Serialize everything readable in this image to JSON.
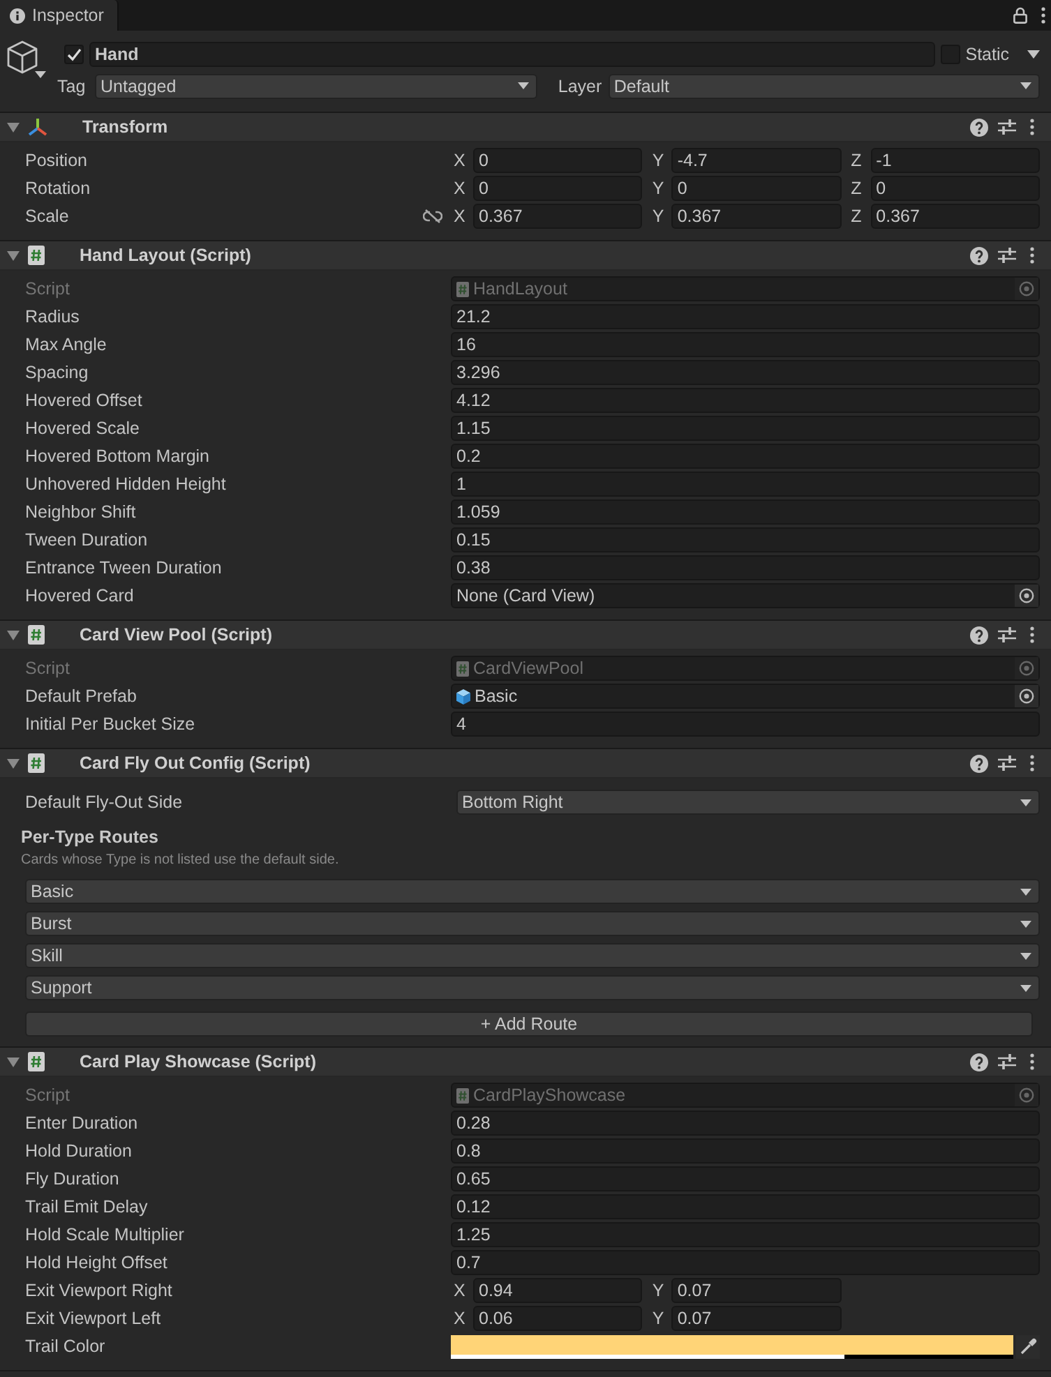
{
  "tab": {
    "label": "Inspector"
  },
  "object": {
    "active": true,
    "name": "Hand",
    "static": false,
    "static_label": "Static",
    "tag_label": "Tag",
    "tag": "Untagged",
    "layer_label": "Layer",
    "layer": "Default"
  },
  "components": [
    {
      "kind": "transform",
      "title": "Transform",
      "expanded": true,
      "rows": [
        {
          "kind": "vector",
          "label": "Position",
          "axes": [
            {
              "axis": "X",
              "value": "0"
            },
            {
              "axis": "Y",
              "value": "-4.7"
            },
            {
              "axis": "Z",
              "value": "-1"
            }
          ]
        },
        {
          "kind": "vector",
          "label": "Rotation",
          "axes": [
            {
              "axis": "X",
              "value": "0"
            },
            {
              "axis": "Y",
              "value": "0"
            },
            {
              "axis": "Z",
              "value": "0"
            }
          ]
        },
        {
          "kind": "scale",
          "label": "Scale",
          "axes": [
            {
              "axis": "X",
              "value": "0.367"
            },
            {
              "axis": "Y",
              "value": "0.367"
            },
            {
              "axis": "Z",
              "value": "0.367"
            }
          ]
        }
      ]
    },
    {
      "kind": "script",
      "title": "Hand Layout (Script)",
      "expanded": true,
      "rows": [
        {
          "kind": "script",
          "label": "Script",
          "value": "HandLayout"
        },
        {
          "kind": "number",
          "label": "Radius",
          "value": "21.2"
        },
        {
          "kind": "number",
          "label": "Max Angle",
          "value": "16"
        },
        {
          "kind": "number",
          "label": "Spacing",
          "value": "3.296"
        },
        {
          "kind": "number",
          "label": "Hovered Offset",
          "value": "4.12"
        },
        {
          "kind": "number",
          "label": "Hovered Scale",
          "value": "1.15"
        },
        {
          "kind": "number",
          "label": "Hovered Bottom Margin",
          "value": "0.2"
        },
        {
          "kind": "number",
          "label": "Unhovered Hidden Height",
          "value": "1"
        },
        {
          "kind": "number",
          "label": "Neighbor Shift",
          "value": "1.059"
        },
        {
          "kind": "number",
          "label": "Tween Duration",
          "value": "0.15"
        },
        {
          "kind": "number",
          "label": "Entrance Tween Duration",
          "value": "0.38"
        },
        {
          "kind": "object",
          "label": "Hovered Card",
          "value": "None (Card View)"
        }
      ]
    },
    {
      "kind": "script",
      "title": "Card View Pool (Script)",
      "expanded": true,
      "rows": [
        {
          "kind": "script",
          "label": "Script",
          "value": "CardViewPool"
        },
        {
          "kind": "prefab",
          "label": "Default Prefab",
          "value": "Basic"
        },
        {
          "kind": "number",
          "label": "Initial Per Bucket Size",
          "value": "4"
        }
      ]
    },
    {
      "kind": "script",
      "title": "Card Fly Out Config (Script)",
      "expanded": true,
      "rows": [
        {
          "kind": "dropdown",
          "label": "Default Fly-Out Side",
          "value": "Bottom Right"
        }
      ],
      "routes": {
        "title": "Per-Type Routes",
        "note": "Cards whose Type is not listed use the default side.",
        "items": [
          "Basic",
          "Burst",
          "Skill",
          "Support"
        ],
        "add_button": "+ Add Route"
      }
    },
    {
      "kind": "script",
      "title": "Card Play Showcase (Script)",
      "expanded": true,
      "rows": [
        {
          "kind": "script",
          "label": "Script",
          "value": "CardPlayShowcase"
        },
        {
          "kind": "number",
          "label": "Enter Duration",
          "value": "0.28"
        },
        {
          "kind": "number",
          "label": "Hold Duration",
          "value": "0.8"
        },
        {
          "kind": "number",
          "label": "Fly Duration",
          "value": "0.65"
        },
        {
          "kind": "number",
          "label": "Trail Emit Delay",
          "value": "0.12"
        },
        {
          "kind": "number",
          "label": "Hold Scale Multiplier",
          "value": "1.25"
        },
        {
          "kind": "number",
          "label": "Hold Height Offset",
          "value": "0.7"
        },
        {
          "kind": "vector",
          "label": "Exit Viewport Right",
          "axes": [
            {
              "axis": "X",
              "value": "0.94"
            },
            {
              "axis": "Y",
              "value": "0.07"
            }
          ]
        },
        {
          "kind": "vector",
          "label": "Exit Viewport Left",
          "axes": [
            {
              "axis": "X",
              "value": "0.06"
            },
            {
              "axis": "Y",
              "value": "0.07"
            }
          ]
        },
        {
          "kind": "color",
          "label": "Trail Color",
          "color": "#ffd477",
          "level": 0.7
        }
      ]
    }
  ]
}
